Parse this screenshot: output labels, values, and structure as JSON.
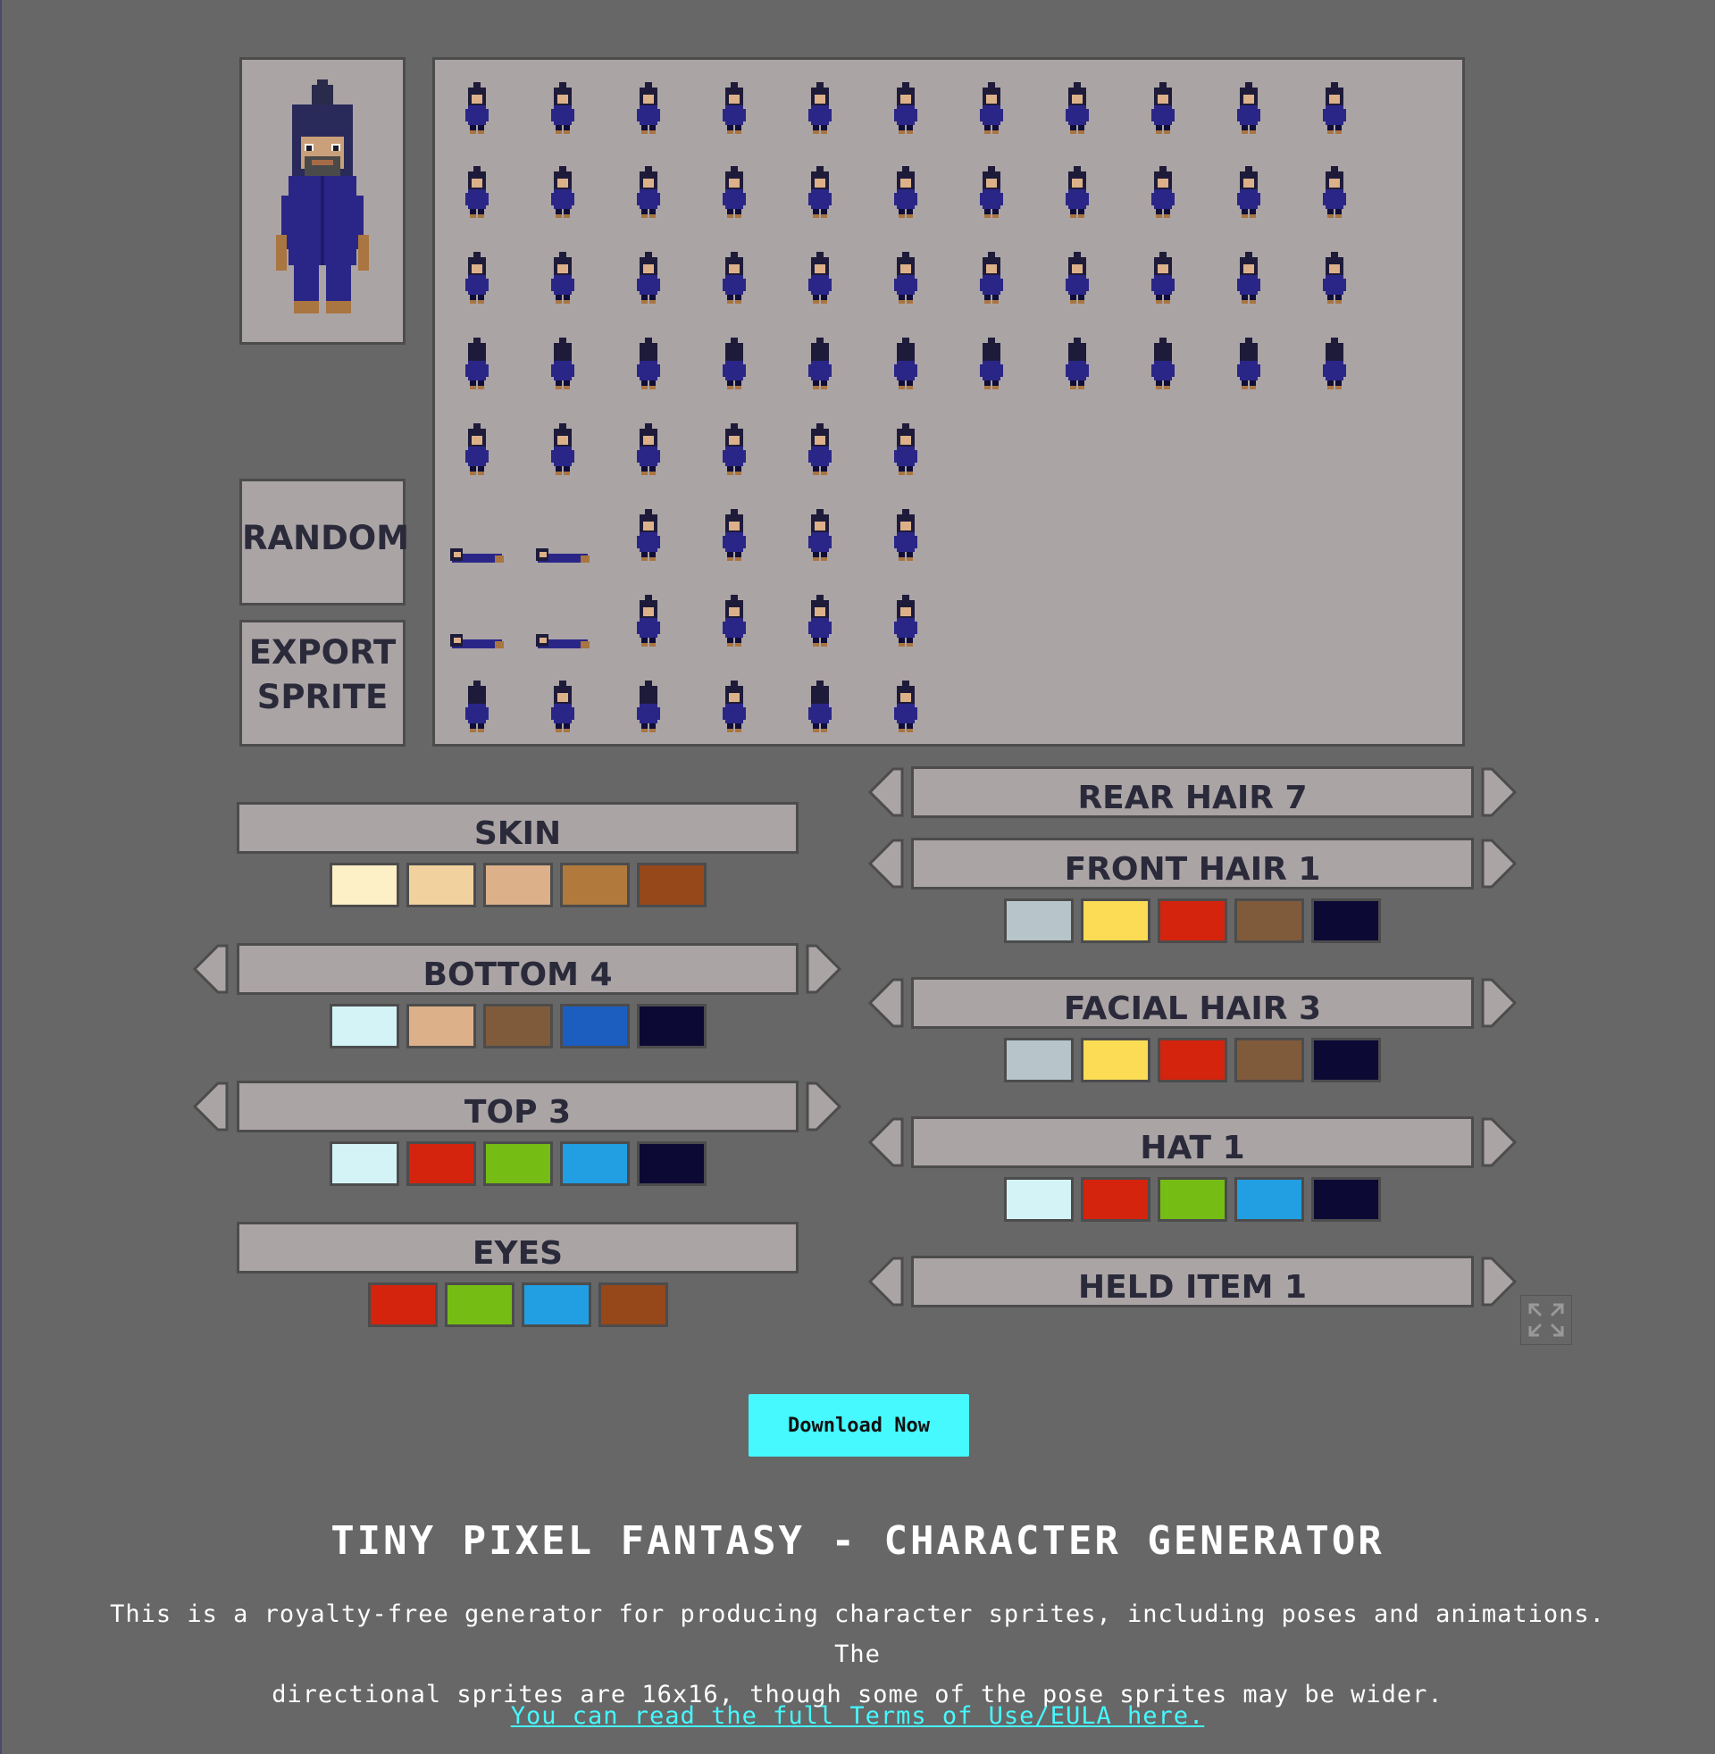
{
  "controls": {
    "random_label": "RANDOM",
    "export_label_1": "EXPORT",
    "export_label_2": "SPRITE"
  },
  "options_left": [
    {
      "label": "SKIN",
      "arrows": false,
      "swatches": [
        "#fdefc6",
        "#f1d29f",
        "#dcb18a",
        "#b1793b",
        "#96481b"
      ]
    },
    {
      "label": "BOTTOM 4",
      "arrows": true,
      "swatches": [
        "#d4f3f6",
        "#dcb18a",
        "#7f5b3c",
        "#1c5ec0",
        "#0d0935"
      ]
    },
    {
      "label": "TOP 3",
      "arrows": true,
      "swatches": [
        "#d4f3f6",
        "#d4240e",
        "#75bd15",
        "#229ee3",
        "#0d0935"
      ]
    },
    {
      "label": "EYES",
      "arrows": false,
      "swatches": [
        "#d4240e",
        "#75bd15",
        "#229ee3",
        "#96481b"
      ]
    }
  ],
  "options_right": [
    {
      "label": "REAR HAIR 7",
      "arrows": true,
      "swatches": []
    },
    {
      "label": "FRONT HAIR 1",
      "arrows": true,
      "swatches": [
        "#b7c5cb",
        "#fbdc54",
        "#d4240e",
        "#7f5b3c",
        "#0d0935"
      ]
    },
    {
      "label": "FACIAL HAIR 3",
      "arrows": true,
      "swatches": [
        "#b7c5cb",
        "#fbdc54",
        "#d4240e",
        "#7f5b3c",
        "#0d0935"
      ]
    },
    {
      "label": "HAT 1",
      "arrows": true,
      "swatches": [
        "#d4f3f6",
        "#d4240e",
        "#75bd15",
        "#229ee3",
        "#0d0935"
      ]
    },
    {
      "label": "HELD ITEM 1",
      "arrows": true,
      "swatches": []
    }
  ],
  "sprite_sheet": {
    "row_counts": [
      11,
      11,
      11,
      11,
      6,
      6,
      6,
      6
    ],
    "outfit_color": "#2a2688",
    "outline_color": "#100d38",
    "hair_color": "#1e1b3a",
    "skin_color": "#dcb18a"
  },
  "download": {
    "label": "Download Now",
    "color": "#45f9ff"
  },
  "info": {
    "title": "TINY PIXEL FANTASY - CHARACTER GENERATOR",
    "description_line1": "This is a royalty-free generator for producing character sprites, including poses and animations. The",
    "description_line2": "directional sprites are 16x16, though some of the pose sprites may be wider.",
    "eula_link": "You can read the full Terms of Use/EULA here."
  },
  "icons": {
    "fullscreen": "fullscreen-icon",
    "arrow_left": "arrow-left-icon",
    "arrow_right": "arrow-right-icon"
  }
}
